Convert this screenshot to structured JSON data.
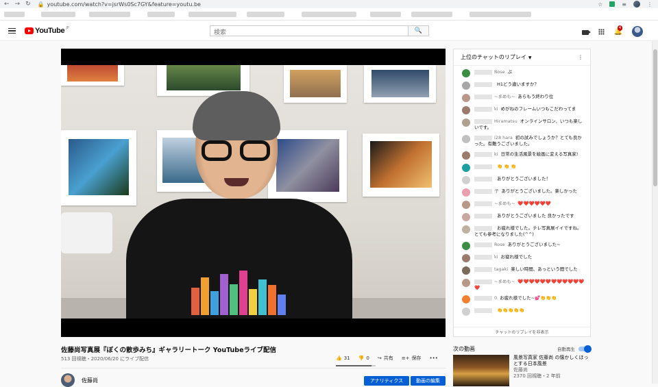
{
  "browser": {
    "url": "youtube.com/watch?v=jsrWs0Sc7GY&feature=youtu.be"
  },
  "header": {
    "logo_text": "YouTube",
    "logo_region": "JP",
    "search_placeholder": "検索",
    "notifications_count": "4"
  },
  "chat": {
    "title": "上位のチャットのリプレイ",
    "footer": "チャットのリプレイを非表示",
    "messages": [
      {
        "name": "Rose",
        "text": "ぷ",
        "avatar_color": "#3c8c46"
      },
      {
        "name": "",
        "text": "H1どう違いますか？",
        "avatar_color": "#a8a8a8"
      },
      {
        "name": "~まめも~",
        "text": "あらもう終わり位",
        "avatar_color": "#b89888"
      },
      {
        "name": "ki",
        "text": "めがねのフレームいつもこだわってま",
        "avatar_color": "#9a7a6a"
      },
      {
        "name": "Hiramatsu",
        "text": "オンラインサロン、いつも楽しいです。",
        "avatar_color": "#b0a090"
      },
      {
        "name": "i28 hara",
        "text": "初の試みでしょうか？とても良かった。有難うございました。",
        "avatar_color": "#c0c0c0"
      },
      {
        "name": "ki",
        "text": "日常の生活風景を絵画に変える写真家!",
        "avatar_color": "#9a7a6a"
      },
      {
        "name": "",
        "text": "👏 👏 👏",
        "avatar_color": "#1c9fa0"
      },
      {
        "name": "",
        "text": "ありがとうございました！",
        "avatar_color": "#d0d0d0"
      },
      {
        "name": "子",
        "text": "ありがとうございました。楽しかった",
        "avatar_color": "#e8a0b0"
      },
      {
        "name": "~まめも~",
        "text": "❤️❤️❤️❤️❤️❤️",
        "avatar_color": "#b89888"
      },
      {
        "name": "",
        "text": "ありがとうございました 良かったです",
        "avatar_color": "#c8a8a0"
      },
      {
        "name": "",
        "text": "お疲れ様でした。テレ写真展イイですね。とても参考になりました(^^)",
        "avatar_color": "#c0b0a0"
      },
      {
        "name": "Rose",
        "text": "ありがとうございました~",
        "avatar_color": "#3c8c46"
      },
      {
        "name": "ki",
        "text": "お疲れ様でした",
        "avatar_color": "#9a7a6a"
      },
      {
        "name": "tagaki",
        "text": "楽しい時間、あっという間でした",
        "avatar_color": "#7a6a5a"
      },
      {
        "name": "~まめも~",
        "text": "❤️❤️❤️❤️❤️❤️❤️❤️❤️❤️❤️❤️❤️",
        "avatar_color": "#b89888"
      },
      {
        "name": "0",
        "text": "お疲れ様でした~💕👏👏👏",
        "avatar_color": "#f08030"
      },
      {
        "name": "",
        "text": "👏👏👏👏👏",
        "avatar_color": "#d0d0d0"
      }
    ]
  },
  "video": {
    "title": "佐藤尚写真展『ぼくの散歩みち』ギャラリートーク YouTubeライブ配信",
    "meta": "513 回視聴・2020/06/20 にライブ配信",
    "likes": "31",
    "dislikes": "0",
    "share_label": "共有",
    "save_label": "保存",
    "more_label": "•••",
    "like_ratio": 0.9
  },
  "channel": {
    "name": "佐藤尚",
    "analytics_button": "アナリティクス",
    "edit_button": "動画の編集"
  },
  "upnext": {
    "label": "次の動画",
    "autoplay_label": "自動再生",
    "autoplay_on": true,
    "items": [
      {
        "title": "風景写真家 佐藤尚 の懐かしくほっとする日本風景",
        "channel": "佐藤尚",
        "meta": "2370 回視聴・2 年前"
      }
    ]
  }
}
